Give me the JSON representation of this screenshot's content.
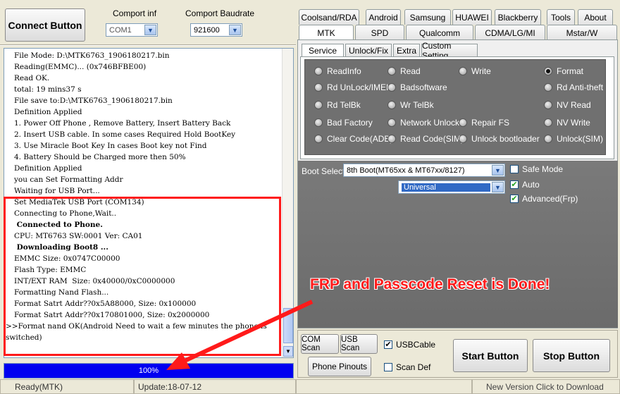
{
  "top": {
    "connect_label": "Connect Button",
    "comport_label": "Comport inf",
    "comport_value": "COM1",
    "baud_label": "Comport Baudrate",
    "baud_value": "921600"
  },
  "log_lines": [
    {
      "text": "File Mode: D:\\MTK6763_1906180217.bin",
      "bold": false
    },
    {
      "text": "Reading(EMMC)... (0x746BFBE00)",
      "bold": false
    },
    {
      "text": "Read OK.",
      "bold": false
    },
    {
      "text": "total: 19 mins37 s",
      "bold": false
    },
    {
      "text": "File save to:D:\\MTK6763_1906180217.bin",
      "bold": false
    },
    {
      "text": "Definition Applied",
      "bold": false
    },
    {
      "text": "1. Power Off Phone , Remove Battery, Insert Battery Back",
      "bold": false
    },
    {
      "text": "2. Insert USB cable. In some cases Required Hold BootKey",
      "bold": false
    },
    {
      "text": "3. Use Miracle Boot Key In cases Boot key not Find",
      "bold": false
    },
    {
      "text": "4. Battery Should be Charged more then 50%",
      "bold": false
    },
    {
      "text": "Definition Applied",
      "bold": false
    },
    {
      "text": "you can Set Formatting Addr",
      "bold": false
    },
    {
      "text": "Waiting for USB Port...",
      "bold": false
    },
    {
      "text": "Set MediaTek USB Port (COM134)",
      "bold": false
    },
    {
      "text": "Connecting to Phone,Wait..",
      "bold": false
    },
    {
      "text": " Connected to Phone.",
      "bold": true
    },
    {
      "text": "CPU: MT6763 SW:0001 Ver: CA01",
      "bold": false
    },
    {
      "text": " Downloading Boot8 ...",
      "bold": true
    },
    {
      "text": "EMMC Size: 0x0747C00000",
      "bold": false
    },
    {
      "text": "Flash Type: EMMC",
      "bold": false
    },
    {
      "text": "INT/EXT RAM  Size: 0x40000/0xC0000000",
      "bold": false
    },
    {
      "text": "Formatting Nand Flash...",
      "bold": false
    },
    {
      "text": "Format Satrt Addr??0x5A88000, Size: 0x100000",
      "bold": false
    },
    {
      "text": "Format Satrt Addr??0x170801000, Size: 0x2000000",
      "bold": false
    }
  ],
  "log_last_line1": ">>Format nand OK(Android Need to wait a few minutes the phone is",
  "log_last_line2": "switched)",
  "progress": {
    "text": "100%",
    "fraction": 1.0
  },
  "tabs_row1": [
    "Coolsand/RDA",
    "Android",
    "Samsung",
    "HUAWEI",
    "Blackberry",
    "Tools",
    "About"
  ],
  "tabs_row2": [
    "MTK",
    "SPD",
    "Qualcomm",
    "CDMA/LG/MI",
    "Mstar/W"
  ],
  "subtabs": [
    "Service",
    "Unlock/Fix",
    "Extra",
    "Custom Setting"
  ],
  "radios": [
    {
      "label": "ReadInfo",
      "on": false
    },
    {
      "label": "Read",
      "on": false
    },
    {
      "label": "Write",
      "on": false
    },
    {
      "label": "Format",
      "on": true
    },
    {
      "label": "Rd UnLock/IMEI",
      "on": false
    },
    {
      "label": "Badsoftware",
      "on": false
    },
    {
      "label": "Rd Anti-theft",
      "on": false
    },
    {
      "label": "Rd TelBk",
      "on": false
    },
    {
      "label": "Wr TelBk",
      "on": false
    },
    {
      "label": "NV Read",
      "on": false
    },
    {
      "label": "Bad Factory",
      "on": false
    },
    {
      "label": "Network Unlock",
      "on": false
    },
    {
      "label": "Repair FS",
      "on": false
    },
    {
      "label": "NV Write",
      "on": false
    },
    {
      "label": "Clear Code(ADB)",
      "on": false
    },
    {
      "label": "Read Code(SIM)",
      "on": false
    },
    {
      "label": "Unlock bootloader",
      "on": false
    },
    {
      "label": "Unlock(SIM)",
      "on": false
    }
  ],
  "boot": {
    "label": "Boot Select:",
    "value": "8th Boot(MT65xx & MT67xx/8127)",
    "mode": "Universal"
  },
  "checks": {
    "safe_mode": "Safe Mode",
    "auto": "Auto",
    "advanced": "Advanced(Frp)"
  },
  "annotation": "FRP and Passcode Reset is Done!",
  "bottom": {
    "com_scan": "COM Scan",
    "usb_scan": "USB Scan",
    "usb_cable": "USBCable",
    "phone_pinouts": "Phone Pinouts",
    "scan_def": "Scan Def",
    "start": "Start Button",
    "stop": "Stop Button"
  },
  "status": {
    "left": "Ready(MTK)",
    "mid": "Update:18-07-12",
    "right": "New Version Click to Download"
  },
  "colors": {
    "panel": "#707070",
    "progress": "#0000f0",
    "annotation": "#ff1a1a"
  }
}
